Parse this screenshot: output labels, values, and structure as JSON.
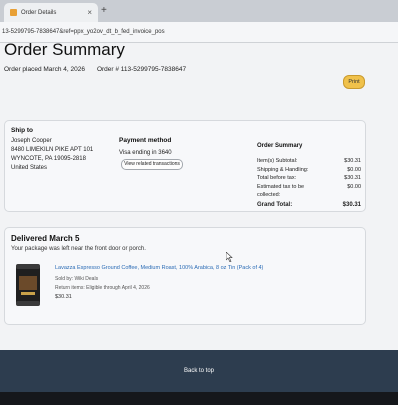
{
  "browser": {
    "tab_title": "Order Details",
    "tab_close": "×",
    "new_tab": "+",
    "url": "13-5299795-7838647&ref=ppx_yo2ov_dt_b_fed_invoice_pos"
  },
  "page": {
    "title": "Order Summary",
    "placed": "Order placed March 4, 2026",
    "order_number": "Order # 113-5299795-7838647",
    "print_label": "Print"
  },
  "ship_to": {
    "heading": "Ship to",
    "lines": [
      "Joseph Cooper",
      "8480 LIMEKILN PIKE APT 101",
      "WYNCOTE, PA 19095-2818",
      "United States"
    ]
  },
  "payment": {
    "heading": "Payment method",
    "card": "Visa ending in 3640",
    "transactions_button": "View related transactions"
  },
  "summary": {
    "heading": "Order Summary",
    "rows": [
      {
        "label": "Item(s) Subtotal:",
        "value": "$30.31"
      },
      {
        "label": "Shipping & Handling:",
        "value": "$0.00"
      },
      {
        "label": "Total before tax:",
        "value": "$30.31"
      },
      {
        "label": "Estimated tax to be collected:",
        "value": "$0.00"
      }
    ],
    "grand_label": "Grand Total:",
    "grand_value": "$30.31"
  },
  "delivery": {
    "title": "Delivered March 5",
    "subtitle": "Your package was left near the front door or porch.",
    "product_name": "Lavazza Espresso Ground Coffee, Medium Roast, 100% Arabica, 8 oz Tin (Pack of 4)",
    "sold_by": "Sold by: Wiki Deals",
    "return_info": "Return items: Eligible through April 4, 2026",
    "price": "$30.31"
  },
  "footer": {
    "back_to_top": "Back to top"
  }
}
